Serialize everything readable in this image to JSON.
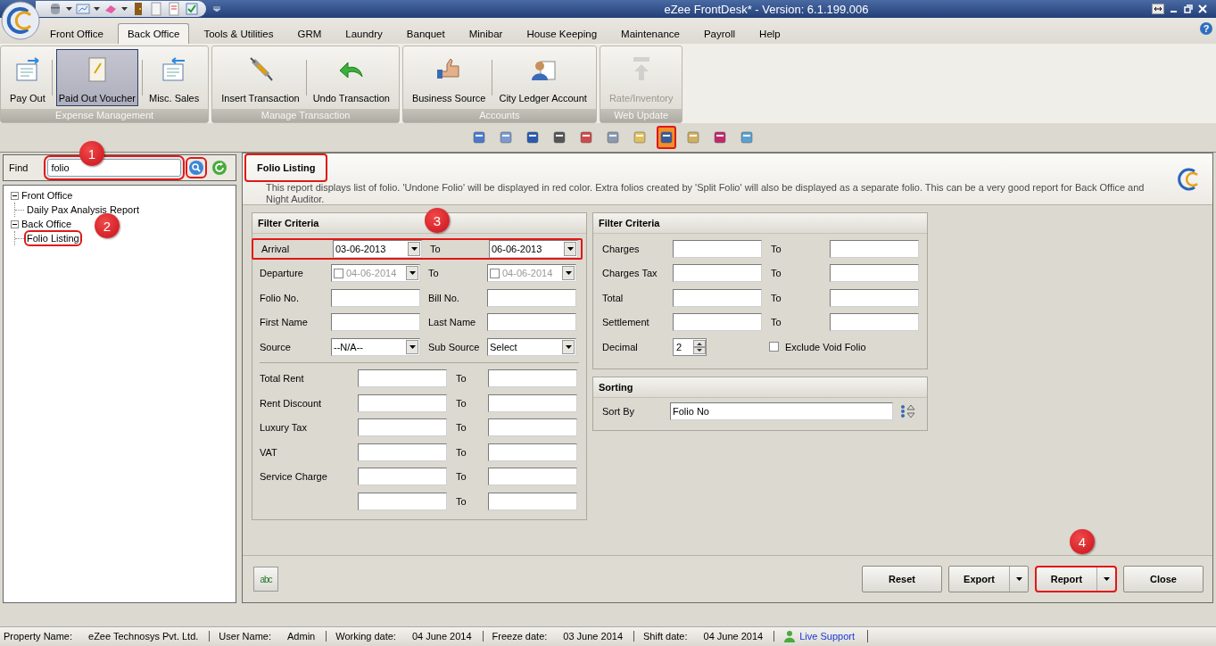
{
  "window": {
    "title": "eZee FrontDesk* - Version: 6.1.199.006"
  },
  "menu_tabs": [
    {
      "label": "Front Office",
      "selected": false
    },
    {
      "label": "Back Office",
      "selected": true
    },
    {
      "label": "Tools & Utilities",
      "selected": false
    },
    {
      "label": "GRM",
      "selected": false
    },
    {
      "label": "Laundry",
      "selected": false
    },
    {
      "label": "Banquet",
      "selected": false
    },
    {
      "label": "Minibar",
      "selected": false
    },
    {
      "label": "House Keeping",
      "selected": false
    },
    {
      "label": "Maintenance",
      "selected": false
    },
    {
      "label": "Payroll",
      "selected": false
    },
    {
      "label": "Help",
      "selected": false
    }
  ],
  "help": "?",
  "ribbon": [
    {
      "label": "Expense Management",
      "buttons": [
        {
          "label": "Pay Out",
          "kind": "payout",
          "selected": false,
          "disabled": false
        },
        {
          "label": "Paid Out Voucher",
          "kind": "voucher",
          "selected": true,
          "disabled": false
        },
        {
          "label": "Misc. Sales",
          "kind": "sales",
          "selected": false,
          "disabled": false
        }
      ]
    },
    {
      "label": "Manage Transaction",
      "buttons": [
        {
          "label": "Insert Transaction",
          "kind": "syringe",
          "selected": false,
          "disabled": false
        },
        {
          "label": "Undo Transaction",
          "kind": "undo",
          "selected": false,
          "disabled": false
        }
      ]
    },
    {
      "label": "Accounts",
      "buttons": [
        {
          "label": "Business Source",
          "kind": "hand",
          "selected": false,
          "disabled": false
        },
        {
          "label": "City Ledger Account",
          "kind": "person",
          "selected": false,
          "disabled": false
        }
      ]
    },
    {
      "label": "Web Update",
      "buttons": [
        {
          "label": "Rate/Inventory",
          "kind": "upload",
          "selected": false,
          "disabled": true
        }
      ]
    }
  ],
  "report_icons": [
    {
      "selected": false
    },
    {
      "selected": false
    },
    {
      "selected": false
    },
    {
      "selected": false
    },
    {
      "selected": false
    },
    {
      "selected": false
    },
    {
      "selected": false
    },
    {
      "selected": true
    },
    {
      "selected": false
    },
    {
      "selected": false
    },
    {
      "selected": false
    }
  ],
  "sidebar": {
    "find_label": "Find",
    "find_value": "folio",
    "find_highlighted": true,
    "search_highlighted": true,
    "tree": [
      {
        "label": "Front Office",
        "expanded": true,
        "children": [
          {
            "label": "Daily Pax Analysis Report",
            "selected": false
          }
        ]
      },
      {
        "label": "Back Office",
        "expanded": true,
        "children": [
          {
            "label": "Folio Listing",
            "selected": true
          }
        ]
      }
    ]
  },
  "report": {
    "title": "Folio Listing",
    "title_highlighted": true,
    "description": "This report displays list of folio. 'Undone Folio' will be displayed in red color. Extra folios created by 'Split Folio' will also be displayed as a separate folio. This can be a very good report for Back Office and Night Auditor.",
    "filter_left": {
      "title": "Filter Criteria",
      "rows": [
        {
          "label": "Arrival",
          "highlighted": true,
          "to_label": "To",
          "from": {
            "kind": "date",
            "value": "03-06-2013",
            "disabled": false
          },
          "to": {
            "kind": "date",
            "value": "06-06-2013",
            "disabled": false
          }
        },
        {
          "label": "Departure",
          "highlighted": false,
          "to_label": "To",
          "from": {
            "kind": "checkdate",
            "value": "04-06-2014",
            "checked": false,
            "disabled": true
          },
          "to": {
            "kind": "checkdate",
            "value": "04-06-2014",
            "checked": false,
            "disabled": true
          }
        },
        {
          "label": "Folio No.",
          "highlighted": false,
          "to_label": "Bill No.",
          "from": {
            "kind": "text"
          },
          "to": {
            "kind": "text"
          }
        },
        {
          "label": "First Name",
          "highlighted": false,
          "to_label": "Last Name",
          "from": {
            "kind": "text"
          },
          "to": {
            "kind": "text"
          }
        },
        {
          "label": "Source",
          "highlighted": false,
          "to_label": "Sub Source",
          "from": {
            "kind": "combo",
            "value": "--N/A--"
          },
          "to": {
            "kind": "combo",
            "value": "Select"
          }
        }
      ],
      "amount_rows": [
        {
          "label": "Total Rent",
          "to_label": "To"
        },
        {
          "label": "Rent Discount",
          "to_label": "To"
        },
        {
          "label": "Luxury Tax",
          "to_label": "To"
        },
        {
          "label": "VAT",
          "to_label": "To"
        },
        {
          "label": "Service Charge",
          "to_label": "To"
        },
        {
          "to_label": "To"
        }
      ]
    },
    "filter_right": {
      "title": "Filter Criteria",
      "rows": [
        {
          "label": "Charges",
          "to_label": "To"
        },
        {
          "label": "Charges Tax",
          "to_label": "To"
        },
        {
          "label": "Total",
          "to_label": "To"
        },
        {
          "label": "Settlement",
          "to_label": "To"
        }
      ],
      "decimal_label": "Decimal",
      "decimal_value": "2",
      "exclude_label": "Exclude Void Folio",
      "exclude_checked": false
    },
    "sorting": {
      "title": "Sorting",
      "label": "Sort By",
      "value": "Folio No"
    },
    "spell_button": "abc",
    "buttons": [
      {
        "label": "Reset",
        "dropdown": false,
        "highlighted": false
      },
      {
        "label": "Export",
        "dropdown": true,
        "highlighted": false
      },
      {
        "label": "Report",
        "dropdown": true,
        "highlighted": true
      },
      {
        "label": "Close",
        "dropdown": false,
        "highlighted": false
      }
    ]
  },
  "callouts": [
    {
      "number": "1"
    },
    {
      "number": "2"
    },
    {
      "number": "3"
    },
    {
      "number": "4"
    }
  ],
  "status_bar": {
    "items": [
      {
        "label": "Property Name:",
        "value": "eZee Technosys Pvt. Ltd."
      },
      {
        "label": "User Name:",
        "value": "Admin"
      },
      {
        "label": "Working date:",
        "value": "04 June 2014"
      },
      {
        "label": "Freeze date:",
        "value": "03 June 2014"
      },
      {
        "label": "Shift date:",
        "value": "04 June 2014"
      }
    ],
    "link": "Live Support"
  }
}
